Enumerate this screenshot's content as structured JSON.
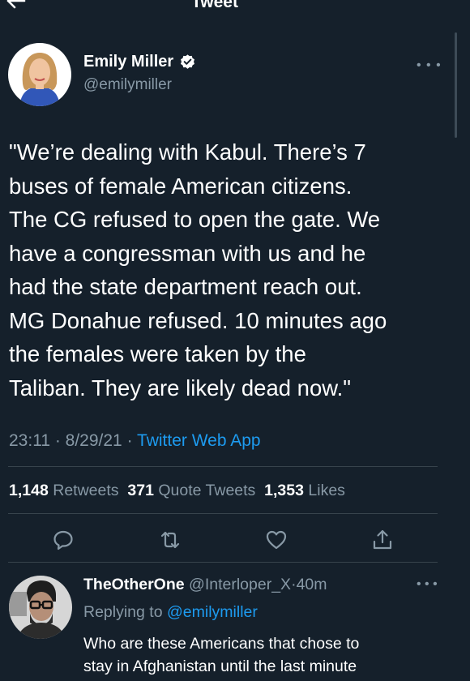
{
  "header": {
    "title": "Tweet"
  },
  "tweet": {
    "author_name": "Emily Miller",
    "author_handle": "@emilymiller",
    "text_lines": [
      "\"We’re dealing with Kabul. There’s 7",
      "buses of female American citizens.",
      "The CG refused to open the gate. We",
      "have a congressman with us and he",
      "had the state department reach out.",
      "MG Donahue refused. 10 minutes ago",
      "the females were taken by the",
      "Taliban. They are likely dead now.\""
    ],
    "time": "23:11",
    "date": "8/29/21",
    "sep": " · ",
    "source": "Twitter Web App",
    "retweets_count": "1,148",
    "retweets_label": "Retweets",
    "quotes_count": "371",
    "quotes_label": "Quote Tweets",
    "likes_count": "1,353",
    "likes_label": "Likes"
  },
  "reply": {
    "name": "TheOtherOne",
    "handle": "@Interloper_X",
    "dot": "·",
    "time": "40m",
    "replying_label": "Replying to",
    "replying_to": "@emilymiller",
    "text_lines": [
      "Who are these Americans that chose to",
      "stay in Afghanistan until the last minute"
    ]
  },
  "icons": {
    "back": "back-arrow-icon",
    "verified": "verified-badge-icon",
    "more": "more-icon",
    "reply": "reply-icon",
    "retweet": "retweet-icon",
    "like": "heart-icon",
    "share": "share-icon"
  },
  "colors": {
    "background": "#15202b",
    "text": "#ffffff",
    "secondary_text": "#8899a6",
    "accent": "#1d9bf0",
    "divider": "#38444d"
  }
}
